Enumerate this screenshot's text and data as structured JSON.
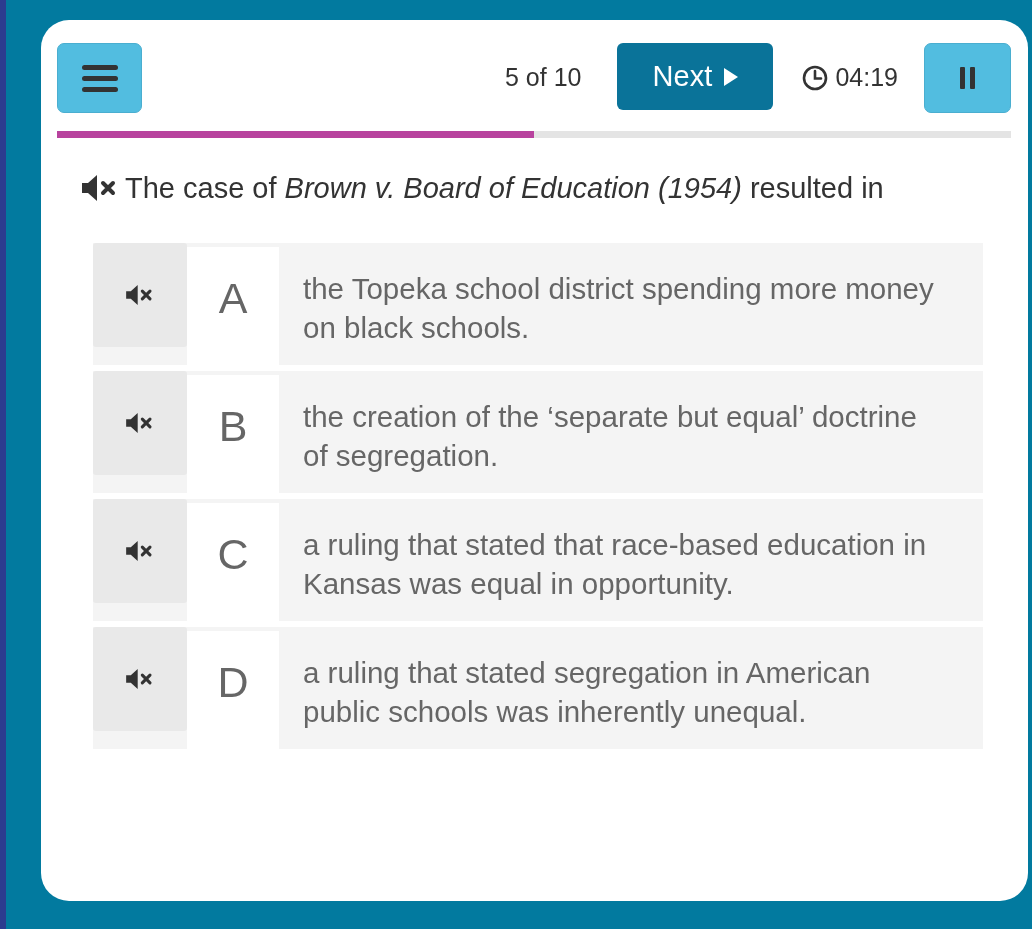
{
  "header": {
    "counter": "5 of 10",
    "next_button": "Next",
    "timer": "04:19"
  },
  "progress": {
    "level": 0.5
  },
  "question": {
    "text": "The case of *Brown v. Board of Education (1954)* resulted in"
  },
  "answers": [
    {
      "letter": "A",
      "text": "the Topeka school district spending more money on black schools.",
      "selected": false
    },
    {
      "letter": "B",
      "text": "the creation of the ‘separate but equal’ doctrine of segregation.",
      "selected": false
    },
    {
      "letter": "C",
      "text": "a ruling that stated that race-based education in Kansas was equal in opportunity.",
      "selected": false
    },
    {
      "letter": "D",
      "text": "a ruling that stated segregation in American public schools was inherently unequal.",
      "selected": false
    }
  ]
}
